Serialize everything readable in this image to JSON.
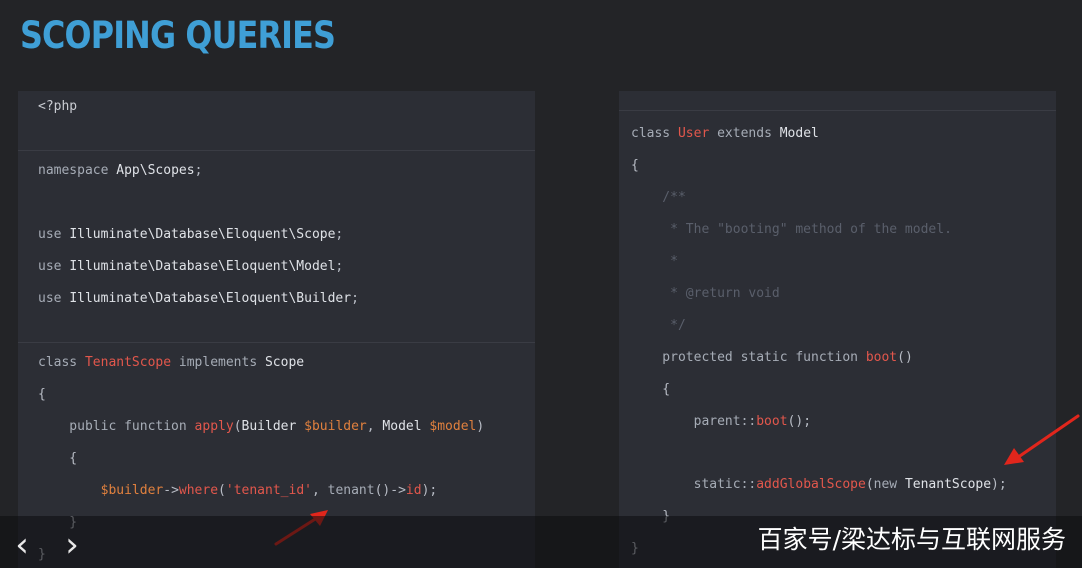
{
  "slide": {
    "title": "SCOPING QUERIES"
  },
  "left_panel": {
    "lines": [
      [
        [
          "<?php",
          "plain"
        ]
      ],
      [
        [
          "namespace ",
          "kw"
        ],
        [
          "App\\Scopes",
          "type"
        ],
        [
          ";",
          "punc"
        ]
      ],
      [
        [
          "use ",
          "kw"
        ],
        [
          "Illuminate\\Database\\Eloquent\\Scope",
          "type"
        ],
        [
          ";",
          "punc"
        ]
      ],
      [
        [
          "use ",
          "kw"
        ],
        [
          "Illuminate\\Database\\Eloquent\\Model",
          "type"
        ],
        [
          ";",
          "punc"
        ]
      ],
      [
        [
          "use ",
          "kw"
        ],
        [
          "Illuminate\\Database\\Eloquent\\Builder",
          "type"
        ],
        [
          ";",
          "punc"
        ]
      ],
      [
        [
          "class ",
          "kw"
        ],
        [
          "TenantScope",
          "cls"
        ],
        [
          " implements ",
          "kw"
        ],
        [
          "Scope",
          "type"
        ]
      ],
      [
        [
          "{",
          "punc"
        ]
      ],
      [
        [
          "    public function ",
          "kw"
        ],
        [
          "apply",
          "fn"
        ],
        [
          "(",
          "punc"
        ],
        [
          "Builder ",
          "type"
        ],
        [
          "$builder",
          "var"
        ],
        [
          ", ",
          "punc"
        ],
        [
          "Model ",
          "type"
        ],
        [
          "$model",
          "var"
        ],
        [
          ")",
          "punc"
        ]
      ],
      [
        [
          "    {",
          "punc"
        ]
      ],
      [
        [
          "        ",
          "plain"
        ],
        [
          "$builder",
          "var"
        ],
        [
          "->",
          "punc"
        ],
        [
          "where",
          "fn"
        ],
        [
          "(",
          "punc"
        ],
        [
          "'tenant_id'",
          "str"
        ],
        [
          ", ",
          "punc"
        ],
        [
          "tenant",
          "kw"
        ],
        [
          "()->",
          "punc"
        ],
        [
          "id",
          "fn"
        ],
        [
          ");",
          "punc"
        ]
      ],
      [
        [
          "    }",
          "punc"
        ]
      ],
      [
        [
          "}",
          "punc"
        ]
      ]
    ]
  },
  "right_panel": {
    "lines": [
      [
        [
          "class ",
          "kw"
        ],
        [
          "User",
          "cls"
        ],
        [
          " extends ",
          "kw"
        ],
        [
          "Model",
          "type"
        ]
      ],
      [
        [
          "{",
          "punc"
        ]
      ],
      [
        [
          "    /**",
          "cmt"
        ]
      ],
      [
        [
          "     * The \"booting\" method of the model.",
          "cmt"
        ]
      ],
      [
        [
          "     *",
          "cmt"
        ]
      ],
      [
        [
          "     * @return void",
          "cmt"
        ]
      ],
      [
        [
          "     */",
          "cmt"
        ]
      ],
      [
        [
          "    protected static function ",
          "kw"
        ],
        [
          "boot",
          "fn"
        ],
        [
          "()",
          "punc"
        ]
      ],
      [
        [
          "    {",
          "punc"
        ]
      ],
      [
        [
          "        parent::",
          "kw"
        ],
        [
          "boot",
          "fn"
        ],
        [
          "();",
          "punc"
        ]
      ],
      [
        [
          "        static::",
          "kw"
        ],
        [
          "addGlobalScope",
          "fn"
        ],
        [
          "(",
          "punc"
        ],
        [
          "new ",
          "kw"
        ],
        [
          "TenantScope",
          "type"
        ],
        [
          ");",
          "punc"
        ]
      ],
      [
        [
          "    }",
          "punc"
        ]
      ],
      [
        [
          "}",
          "punc"
        ]
      ]
    ]
  },
  "colors": {
    "title": "#3f9fd6",
    "accent_red": "#e2574c",
    "panel_bg": "#2c2e35",
    "page_bg": "#232427",
    "arrow": "#e1261c"
  },
  "nav": {
    "prev_icon": "chevron-left-icon",
    "next_icon": "chevron-right-icon",
    "prev_glyph": "‹",
    "next_glyph": "›"
  },
  "watermark": {
    "text": "百家号/梁达标与互联网服务"
  }
}
